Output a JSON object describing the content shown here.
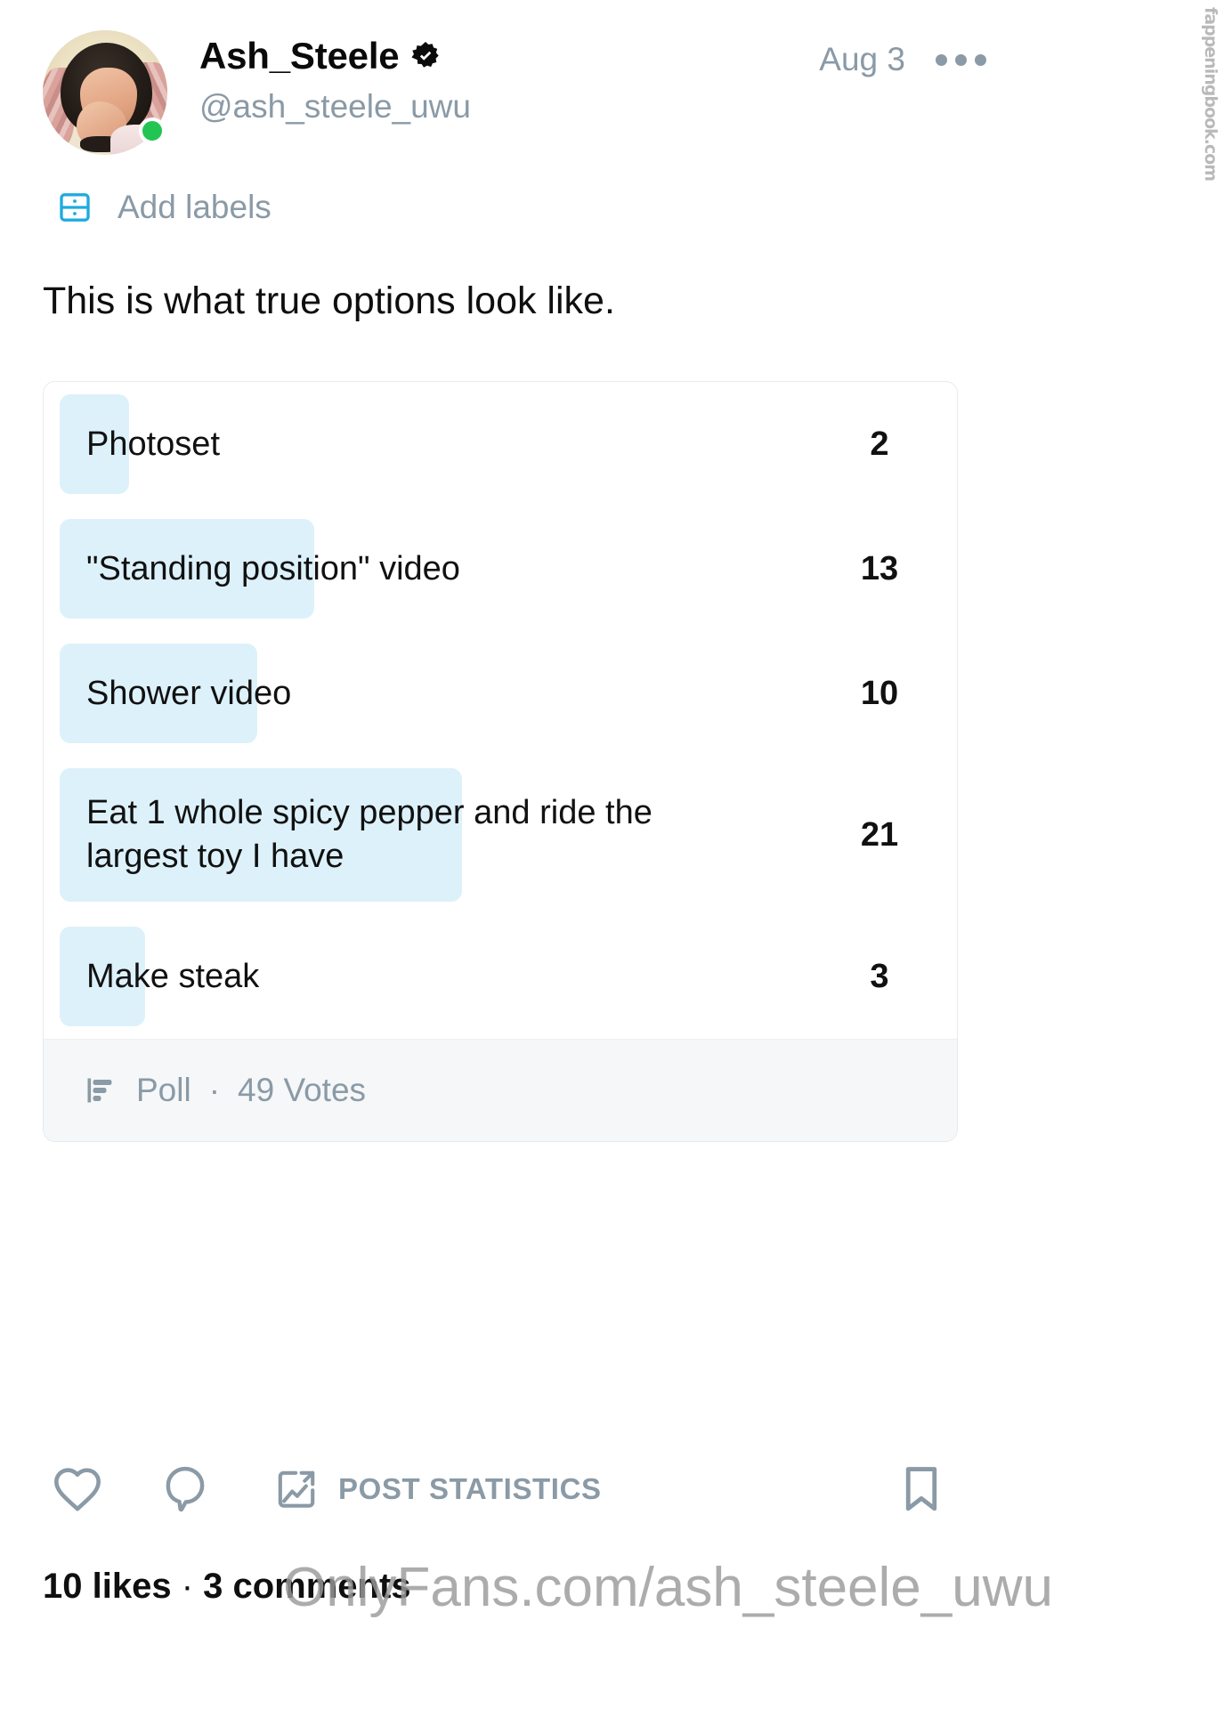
{
  "header": {
    "display_name": "Ash_Steele",
    "handle": "@ash_steele_uwu",
    "date": "Aug 3",
    "verified_icon": "verified-badge-icon",
    "more_icon": "more-options-icon",
    "online_status": "online",
    "avatar_alt": "avatar"
  },
  "labels": {
    "text": "Add labels",
    "icon": "labels-drawer-icon",
    "icon_color": "#1eaadf"
  },
  "post": {
    "text": "This is what true options look like."
  },
  "poll": {
    "footer_label": "Poll",
    "separator": "·",
    "votes_label": "49 Votes",
    "total_votes": 49,
    "bar_color": "#ddf1fa",
    "options": [
      {
        "label": "Photoset",
        "votes": "2"
      },
      {
        "label": "\"Standing position\" video",
        "votes": "13"
      },
      {
        "label": "Shower video",
        "votes": "10"
      },
      {
        "label": "Eat 1 whole spicy pepper and ride the largest toy I have",
        "votes": "21"
      },
      {
        "label": "Make steak",
        "votes": "3"
      }
    ]
  },
  "chart_data": {
    "type": "bar",
    "title": "This is what true options look like.",
    "categories": [
      "Photoset",
      "\"Standing position\" video",
      "Shower video",
      "Eat 1 whole spicy pepper and ride the largest toy I have",
      "Make steak"
    ],
    "values": [
      2,
      13,
      10,
      21,
      3
    ],
    "xlabel": "Votes",
    "ylabel": "",
    "xlim": [
      0,
      21
    ],
    "grid": false,
    "legend": "none",
    "total": 49,
    "orientation": "horizontal"
  },
  "actions": {
    "like_icon": "heart-icon",
    "comment_icon": "comment-icon",
    "stats_icon": "post-statistics-icon",
    "stats_label": "POST STATISTICS",
    "bookmark_icon": "bookmark-icon"
  },
  "stats": {
    "likes": "10 likes",
    "separator": "·",
    "comments": "3 comments"
  },
  "watermarks": {
    "side": "fappeningbook.com",
    "center": "OnlyFans.com/ash_steele_uwu"
  }
}
